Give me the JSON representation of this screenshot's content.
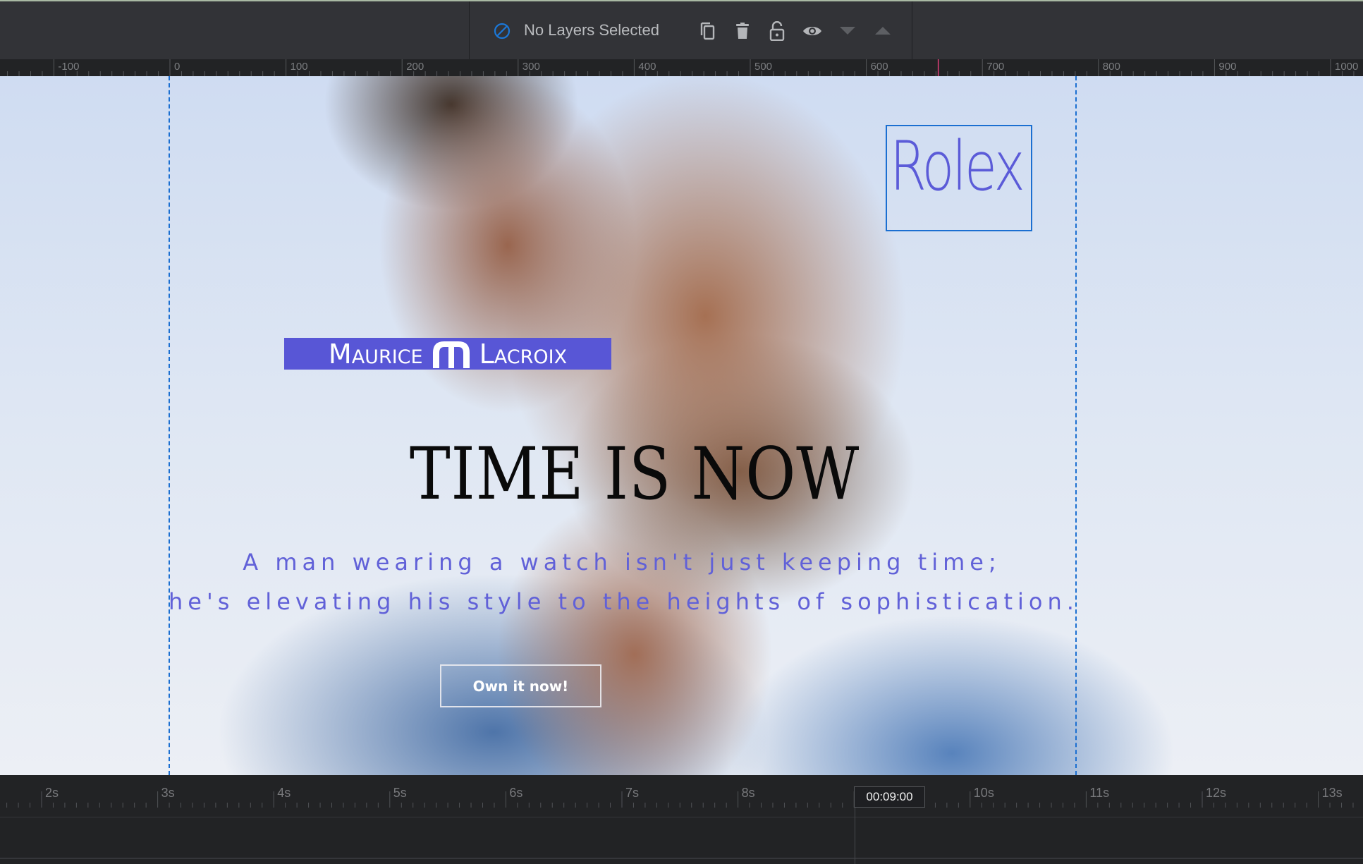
{
  "toolbar": {
    "selection_status": "No Layers Selected",
    "selection_icon": "no-selection-icon",
    "buttons": [
      {
        "name": "duplicate-layer-button",
        "icon": "copy-icon",
        "enabled": true
      },
      {
        "name": "delete-layer-button",
        "icon": "trash-icon",
        "enabled": true
      },
      {
        "name": "lock-layer-button",
        "icon": "unlock-icon",
        "enabled": true
      },
      {
        "name": "toggle-visibility-button",
        "icon": "eye-icon",
        "enabled": true
      },
      {
        "name": "move-layer-down-button",
        "icon": "triangle-down-icon",
        "enabled": false
      },
      {
        "name": "move-layer-up-button",
        "icon": "triangle-up-icon",
        "enabled": false
      }
    ]
  },
  "ruler": {
    "labels": [
      "-100",
      "0",
      "100",
      "200",
      "300",
      "400",
      "500",
      "600",
      "700",
      "800",
      "900",
      "1000"
    ],
    "values": [
      -100,
      0,
      100,
      200,
      300,
      400,
      500,
      600,
      700,
      800,
      900,
      1000
    ],
    "marker_value": 662
  },
  "canvas": {
    "rolex_text": "Rolex",
    "brand_logo_left": "Maurice",
    "brand_logo_right": "Lacroix",
    "headline": "TIME IS NOW",
    "subtitle_line1": "A man wearing a watch isn't just keeping time;",
    "subtitle_line2": "he's elevating his style to the heights of sophistication.",
    "cta_label": "Own it now!",
    "colors": {
      "accent_purple": "#5856d6",
      "subtitle_purple": "#6161d8",
      "selection_blue": "#1b6fd1"
    }
  },
  "timeline": {
    "labels": [
      "2s",
      "3s",
      "4s",
      "5s",
      "6s",
      "7s",
      "8s",
      "9s",
      "10s",
      "11s",
      "12s",
      "13s"
    ],
    "seconds": [
      2,
      3,
      4,
      5,
      6,
      7,
      8,
      9,
      10,
      11,
      12,
      13
    ],
    "current_time": "00:09:00"
  }
}
